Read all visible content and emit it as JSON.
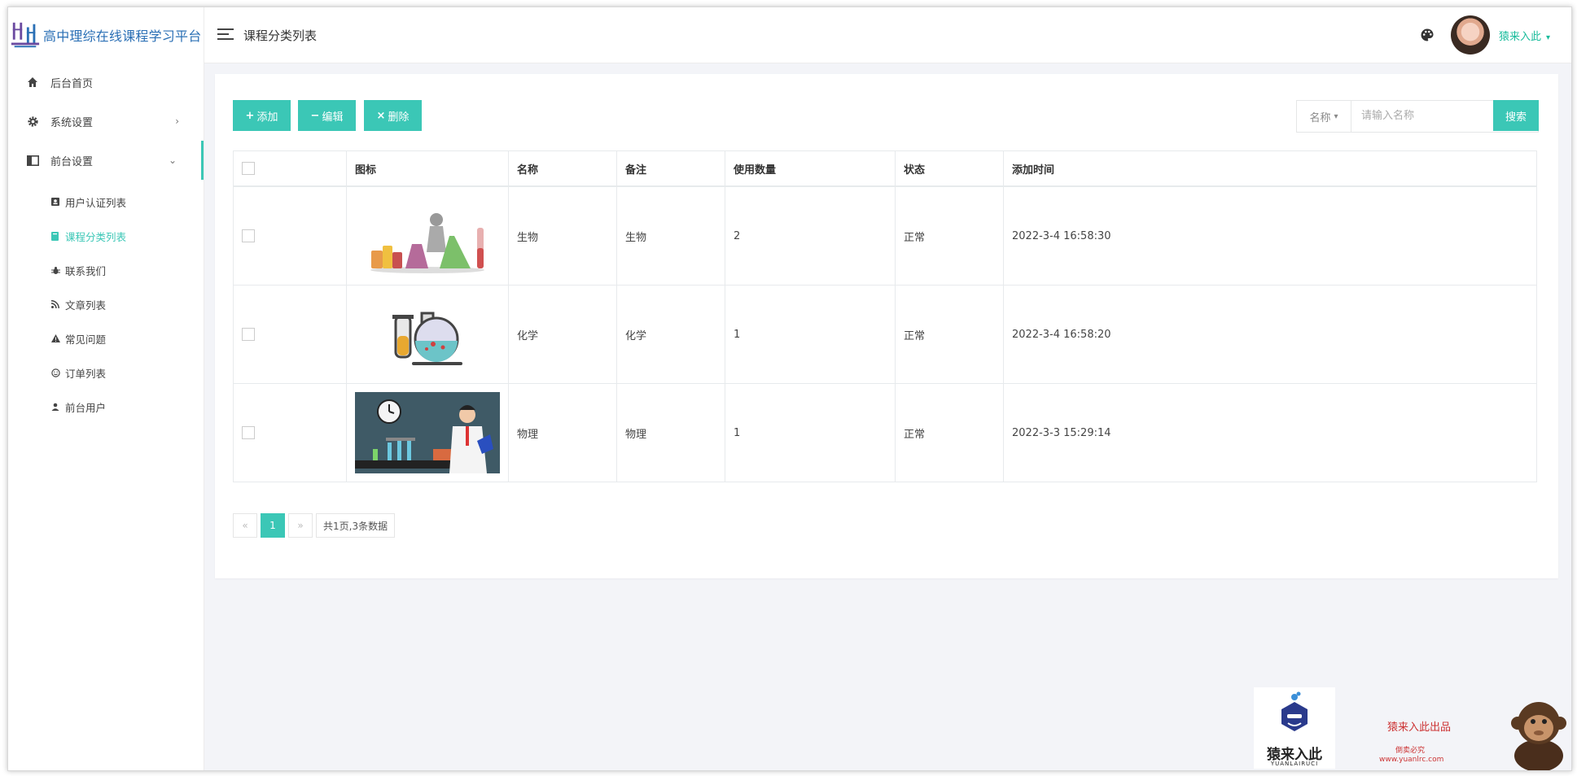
{
  "app": {
    "title": "高中理综在线课程学习平台"
  },
  "sidebar": {
    "items": [
      {
        "label": "后台首页",
        "icon": "home-icon"
      },
      {
        "label": "系统设置",
        "icon": "gear-icon"
      },
      {
        "label": "前台设置",
        "icon": "layout-icon"
      }
    ],
    "submenu": [
      {
        "label": "用户认证列表",
        "icon": "id-card-icon"
      },
      {
        "label": "课程分类列表",
        "icon": "book-icon",
        "active": true
      },
      {
        "label": "联系我们",
        "icon": "bug-icon"
      },
      {
        "label": "文章列表",
        "icon": "rss-icon"
      },
      {
        "label": "常见问题",
        "icon": "warning-icon"
      },
      {
        "label": "订单列表",
        "icon": "smile-icon"
      },
      {
        "label": "前台用户",
        "icon": "user-icon"
      }
    ]
  },
  "header": {
    "page_title": "课程分类列表",
    "user_name": "猿来入此"
  },
  "toolbar": {
    "add_label": "添加",
    "edit_label": "编辑",
    "delete_label": "删除",
    "search_field": "名称",
    "search_placeholder": "请输入名称",
    "search_button": "搜索"
  },
  "table": {
    "columns": [
      "图标",
      "名称",
      "备注",
      "使用数量",
      "状态",
      "添加时间"
    ],
    "rows": [
      {
        "icon": "biology-lab-image",
        "name": "生物",
        "remark": "生物",
        "count": "2",
        "status": "正常",
        "time": "2022-3-4 16:58:30"
      },
      {
        "icon": "chemistry-flask-image",
        "name": "化学",
        "remark": "化学",
        "count": "1",
        "status": "正常",
        "time": "2022-3-4 16:58:20"
      },
      {
        "icon": "physics-scientist-image",
        "name": "物理",
        "remark": "物理",
        "count": "1",
        "status": "正常",
        "time": "2022-3-3 15:29:14"
      }
    ]
  },
  "pagination": {
    "prev": "«",
    "current": "1",
    "next": "»",
    "info": "共1页,3条数据"
  },
  "watermark": {
    "brand": "猿来入此",
    "brand_en": "YUANLAIRUCI",
    "title": "猿来入此出品",
    "sub": "倒卖必究",
    "url": "www.yuanlrc.com"
  },
  "colors": {
    "accent": "#3bc7b6",
    "status_green": "#1ab394",
    "brand_blue": "#2a6fb5"
  }
}
